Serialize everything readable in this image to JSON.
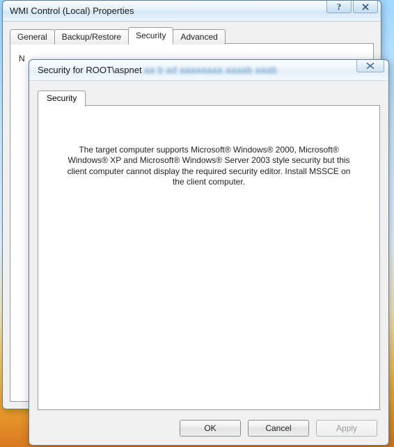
{
  "parent": {
    "title": "WMI Control (Local) Properties",
    "tabs": {
      "general": "General",
      "backup": "Backup/Restore",
      "security": "Security",
      "advanced": "Advanced"
    },
    "visible_text_fragment": "N"
  },
  "child": {
    "title_prefix": "Security for ROOT\\aspnet",
    "title_blurred_suffix": "aa b ad aaaaaaaa aaaab aaab",
    "tab_label": "Security",
    "message": "The target computer supports Microsoft® Windows® 2000, Microsoft® Windows® XP and Microsoft® Windows® Server 2003 style security but this client computer cannot display the required security editor. Install MSSCE on the client computer.",
    "buttons": {
      "ok": "OK",
      "cancel": "Cancel",
      "apply": "Apply"
    }
  },
  "icons": {
    "help": "?",
    "close": "✕"
  }
}
